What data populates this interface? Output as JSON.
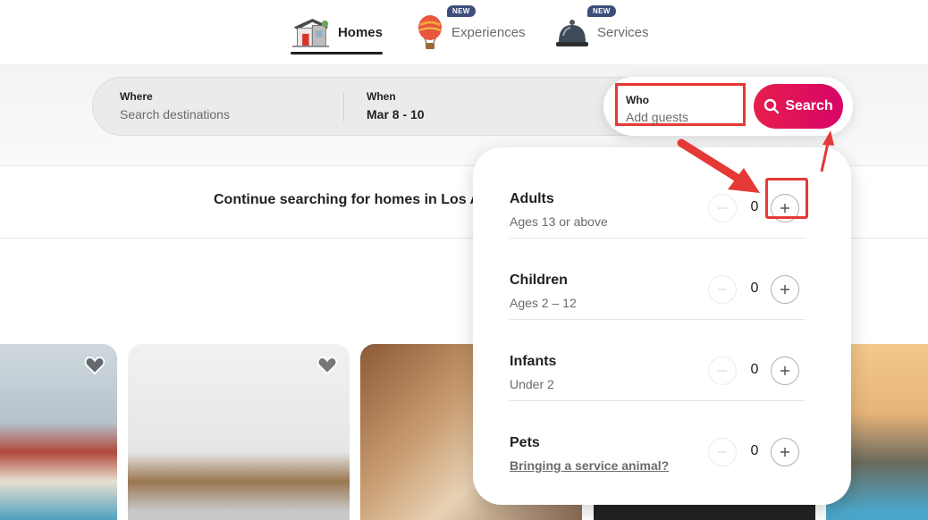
{
  "tabs": [
    {
      "label": "Homes",
      "icon": "house-icon",
      "active": true
    },
    {
      "label": "Experiences",
      "icon": "hot-air-balloon-icon",
      "badge": "NEW"
    },
    {
      "label": "Services",
      "icon": "service-bell-icon",
      "badge": "NEW"
    }
  ],
  "search": {
    "where_label": "Where",
    "where_placeholder": "Search destinations",
    "when_label": "When",
    "when_value": "Mar 8 - 10",
    "who_label": "Who",
    "who_placeholder": "Add guests",
    "search_button": "Search"
  },
  "continue_text": "Continue searching for homes in Los An",
  "guests": [
    {
      "title": "Adults",
      "subtitle": "Ages 13 or above",
      "count": "0"
    },
    {
      "title": "Children",
      "subtitle": "Ages 2 – 12",
      "count": "0"
    },
    {
      "title": "Infants",
      "subtitle": "Under 2",
      "count": "0"
    },
    {
      "title": "Pets",
      "subtitle": "Bringing a service animal?",
      "count": "0"
    }
  ],
  "colors": {
    "brand": "#e61e4d",
    "annotation": "#e53935",
    "badge": "#3c4e7a"
  }
}
